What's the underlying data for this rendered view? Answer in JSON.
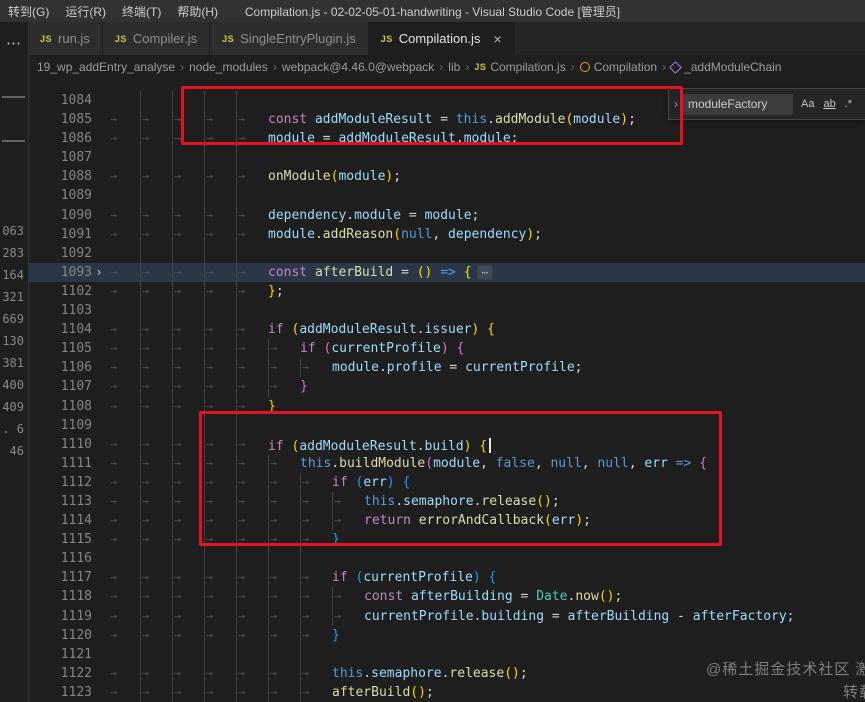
{
  "title_bar": {
    "menus": [
      "转到(G)",
      "运行(R)",
      "终端(T)",
      "帮助(H)"
    ],
    "title": "Compilation.js - 02-02-05-01-handwriting - Visual Studio Code [管理员]"
  },
  "tab_bar": {
    "tabs": [
      {
        "label": "run.js",
        "icon": "JS",
        "active": false
      },
      {
        "label": "Compiler.js",
        "icon": "JS",
        "active": false
      },
      {
        "label": "SingleEntryPlugin.js",
        "icon": "JS",
        "active": false
      },
      {
        "label": "Compilation.js",
        "icon": "JS",
        "active": true
      }
    ]
  },
  "breadcrumb": {
    "separator": "›",
    "items": [
      {
        "label": "19_wp_addEntry_analyse"
      },
      {
        "label": "node_modules"
      },
      {
        "label": "webpack@4.46.0@webpack"
      },
      {
        "label": "lib"
      },
      {
        "label": "Compilation.js",
        "icon": "js"
      },
      {
        "label": "Compilation",
        "icon": "class"
      },
      {
        "label": "_addModuleChain",
        "icon": "method"
      }
    ]
  },
  "find_widget": {
    "value": "moduleFactory",
    "toggles": [
      {
        "label": "Aa",
        "name": "match-case-toggle"
      },
      {
        "label": "ab",
        "name": "whole-word-toggle"
      },
      {
        "label": ".*",
        "name": "regex-toggle"
      }
    ]
  },
  "left_strip": {
    "numbers": [
      "063",
      "283",
      "164",
      "321",
      "669",
      "130",
      "381",
      "400",
      "409",
      ". 6",
      ". 46"
    ]
  },
  "icons": {
    "overflow": "⋯",
    "close": "×",
    "find_chevron": "›",
    "fold_collapsed": "›",
    "tab_whitespace": "→",
    "folded_placeholder": "⋯"
  },
  "colors": {
    "annotation_red": "#e81123",
    "keyword": "#c586c0",
    "variable": "#9cdcfe",
    "function": "#dcdcaa",
    "storage": "#569cd6",
    "literal": "#569cd6",
    "class": "#4ec9b0",
    "default": "#d4d4d4",
    "bracket_gold": "#ffd700",
    "bracket_pink": "#da70d6",
    "bracket_blue": "#179fff",
    "js_icon": "#cbcb41"
  },
  "watermark": {
    "line1": "@稀土掘金技术社区 激",
    "line2": "转载"
  },
  "editor": {
    "lines": [
      {
        "num": "1084",
        "ind": 5,
        "blank": true
      },
      {
        "num": "1085",
        "ind": 5,
        "tok": [
          [
            "const ",
            "kw"
          ],
          [
            "addModuleResult",
            "v"
          ],
          [
            " = ",
            "op"
          ],
          [
            "this",
            "th"
          ],
          [
            ".",
            "op"
          ],
          [
            "addModule",
            "fn"
          ],
          [
            "(",
            "g"
          ],
          [
            "module",
            "v"
          ],
          [
            ")",
            "g"
          ],
          [
            ";",
            "op"
          ]
        ]
      },
      {
        "num": "1086",
        "ind": 5,
        "tok": [
          [
            "module",
            "v"
          ],
          [
            " = ",
            "op"
          ],
          [
            "addModuleResult",
            "v"
          ],
          [
            ".",
            "op"
          ],
          [
            "module",
            "v"
          ],
          [
            ";",
            "op"
          ]
        ]
      },
      {
        "num": "1087",
        "ind": 5,
        "blank": true
      },
      {
        "num": "1088",
        "ind": 5,
        "tok": [
          [
            "onModule",
            "fn"
          ],
          [
            "(",
            "g"
          ],
          [
            "module",
            "v"
          ],
          [
            ")",
            "g"
          ],
          [
            ";",
            "op"
          ]
        ]
      },
      {
        "num": "1089",
        "ind": 5,
        "blank": true
      },
      {
        "num": "1090",
        "ind": 5,
        "tok": [
          [
            "dependency",
            "v"
          ],
          [
            ".",
            "op"
          ],
          [
            "module",
            "v"
          ],
          [
            " = ",
            "op"
          ],
          [
            "module",
            "v"
          ],
          [
            ";",
            "op"
          ]
        ]
      },
      {
        "num": "1091",
        "ind": 5,
        "tok": [
          [
            "module",
            "v"
          ],
          [
            ".",
            "op"
          ],
          [
            "addReason",
            "fn"
          ],
          [
            "(",
            "g"
          ],
          [
            "null",
            "lit"
          ],
          [
            ", ",
            "op"
          ],
          [
            "dependency",
            "v"
          ],
          [
            ")",
            "g"
          ],
          [
            ";",
            "op"
          ]
        ]
      },
      {
        "num": "1092",
        "ind": 5,
        "blank": true
      },
      {
        "num": "1093",
        "ind": 5,
        "hl": true,
        "fold": true,
        "tok": [
          [
            "const ",
            "kw"
          ],
          [
            "afterBuild",
            "fn"
          ],
          [
            " = ",
            "op"
          ],
          [
            "()",
            "g"
          ],
          [
            " ",
            "op"
          ],
          [
            "=>",
            "th"
          ],
          [
            " ",
            "op"
          ],
          [
            "{",
            "g"
          ]
        ]
      },
      {
        "num": "1102",
        "ind": 5,
        "tok": [
          [
            "}",
            "g"
          ],
          [
            ";",
            "op"
          ]
        ]
      },
      {
        "num": "1103",
        "ind": 5,
        "blank": true
      },
      {
        "num": "1104",
        "ind": 5,
        "tok": [
          [
            "if",
            "kw"
          ],
          [
            " ",
            "op"
          ],
          [
            "(",
            "g"
          ],
          [
            "addModuleResult",
            "v"
          ],
          [
            ".",
            "op"
          ],
          [
            "issuer",
            "v"
          ],
          [
            ")",
            "g"
          ],
          [
            " ",
            "op"
          ],
          [
            "{",
            "g"
          ]
        ]
      },
      {
        "num": "1105",
        "ind": 6,
        "tok": [
          [
            "if",
            "kw"
          ],
          [
            " ",
            "op"
          ],
          [
            "(",
            "p"
          ],
          [
            "currentProfile",
            "v"
          ],
          [
            ")",
            "p"
          ],
          [
            " ",
            "op"
          ],
          [
            "{",
            "p"
          ]
        ]
      },
      {
        "num": "1106",
        "ind": 7,
        "tok": [
          [
            "module",
            "v"
          ],
          [
            ".",
            "op"
          ],
          [
            "profile",
            "v"
          ],
          [
            " = ",
            "op"
          ],
          [
            "currentProfile",
            "v"
          ],
          [
            ";",
            "op"
          ]
        ]
      },
      {
        "num": "1107",
        "ind": 6,
        "tok": [
          [
            "}",
            "p"
          ]
        ]
      },
      {
        "num": "1108",
        "ind": 5,
        "tok": [
          [
            "}",
            "g"
          ]
        ]
      },
      {
        "num": "1109",
        "ind": 5,
        "blank": true
      },
      {
        "num": "1110",
        "ind": 5,
        "cursor": true,
        "tok": [
          [
            "if",
            "kw"
          ],
          [
            " ",
            "op"
          ],
          [
            "(",
            "g"
          ],
          [
            "addModuleResult",
            "v"
          ],
          [
            ".",
            "op"
          ],
          [
            "build",
            "v"
          ],
          [
            ")",
            "g"
          ],
          [
            " ",
            "op"
          ],
          [
            "{",
            "g"
          ]
        ]
      },
      {
        "num": "1111",
        "ind": 6,
        "tok": [
          [
            "this",
            "th"
          ],
          [
            ".",
            "op"
          ],
          [
            "buildModule",
            "fn"
          ],
          [
            "(",
            "p"
          ],
          [
            "module",
            "v"
          ],
          [
            ", ",
            "op"
          ],
          [
            "false",
            "lit"
          ],
          [
            ", ",
            "op"
          ],
          [
            "null",
            "lit"
          ],
          [
            ", ",
            "op"
          ],
          [
            "null",
            "lit"
          ],
          [
            ", ",
            "op"
          ],
          [
            "err",
            "v"
          ],
          [
            " ",
            "op"
          ],
          [
            "=>",
            "th"
          ],
          [
            " ",
            "op"
          ],
          [
            "{",
            "p"
          ]
        ]
      },
      {
        "num": "1112",
        "ind": 7,
        "tok": [
          [
            "if",
            "kw"
          ],
          [
            " ",
            "op"
          ],
          [
            "(",
            "bl"
          ],
          [
            "err",
            "v"
          ],
          [
            ")",
            "bl"
          ],
          [
            " ",
            "op"
          ],
          [
            "{",
            "bl"
          ]
        ]
      },
      {
        "num": "1113",
        "ind": 8,
        "tok": [
          [
            "this",
            "th"
          ],
          [
            ".",
            "op"
          ],
          [
            "semaphore",
            "v"
          ],
          [
            ".",
            "op"
          ],
          [
            "release",
            "fn"
          ],
          [
            "()",
            "g"
          ],
          [
            ";",
            "op"
          ]
        ]
      },
      {
        "num": "1114",
        "ind": 8,
        "tok": [
          [
            "return",
            "kw"
          ],
          [
            " ",
            "op"
          ],
          [
            "errorAndCallback",
            "fn"
          ],
          [
            "(",
            "g"
          ],
          [
            "err",
            "v"
          ],
          [
            ")",
            "g"
          ],
          [
            ";",
            "op"
          ]
        ]
      },
      {
        "num": "1115",
        "ind": 7,
        "tok": [
          [
            "}",
            "bl"
          ]
        ]
      },
      {
        "num": "1116",
        "ind": 7,
        "blank": true
      },
      {
        "num": "1117",
        "ind": 7,
        "tok": [
          [
            "if",
            "kw"
          ],
          [
            " ",
            "op"
          ],
          [
            "(",
            "bl"
          ],
          [
            "currentProfile",
            "v"
          ],
          [
            ")",
            "bl"
          ],
          [
            " ",
            "op"
          ],
          [
            "{",
            "bl"
          ]
        ]
      },
      {
        "num": "1118",
        "ind": 8,
        "tok": [
          [
            "const ",
            "kw"
          ],
          [
            "afterBuilding",
            "v"
          ],
          [
            " = ",
            "op"
          ],
          [
            "Date",
            "cls"
          ],
          [
            ".",
            "op"
          ],
          [
            "now",
            "fn"
          ],
          [
            "()",
            "g"
          ],
          [
            ";",
            "op"
          ]
        ]
      },
      {
        "num": "1119",
        "ind": 8,
        "tok": [
          [
            "currentProfile",
            "v"
          ],
          [
            ".",
            "op"
          ],
          [
            "building",
            "v"
          ],
          [
            " = ",
            "op"
          ],
          [
            "afterBuilding",
            "v"
          ],
          [
            " - ",
            "op"
          ],
          [
            "afterFactory",
            "v"
          ],
          [
            ";",
            "op"
          ]
        ]
      },
      {
        "num": "1120",
        "ind": 7,
        "tok": [
          [
            "}",
            "bl"
          ]
        ]
      },
      {
        "num": "1121",
        "ind": 7,
        "blank": true
      },
      {
        "num": "1122",
        "ind": 7,
        "tok": [
          [
            "this",
            "th"
          ],
          [
            ".",
            "op"
          ],
          [
            "semaphore",
            "v"
          ],
          [
            ".",
            "op"
          ],
          [
            "release",
            "fn"
          ],
          [
            "()",
            "g"
          ],
          [
            ";",
            "op"
          ]
        ]
      },
      {
        "num": "1123",
        "ind": 7,
        "tok": [
          [
            "afterBuild",
            "fn"
          ],
          [
            "()",
            "g"
          ],
          [
            ";",
            "op"
          ]
        ]
      }
    ]
  }
}
